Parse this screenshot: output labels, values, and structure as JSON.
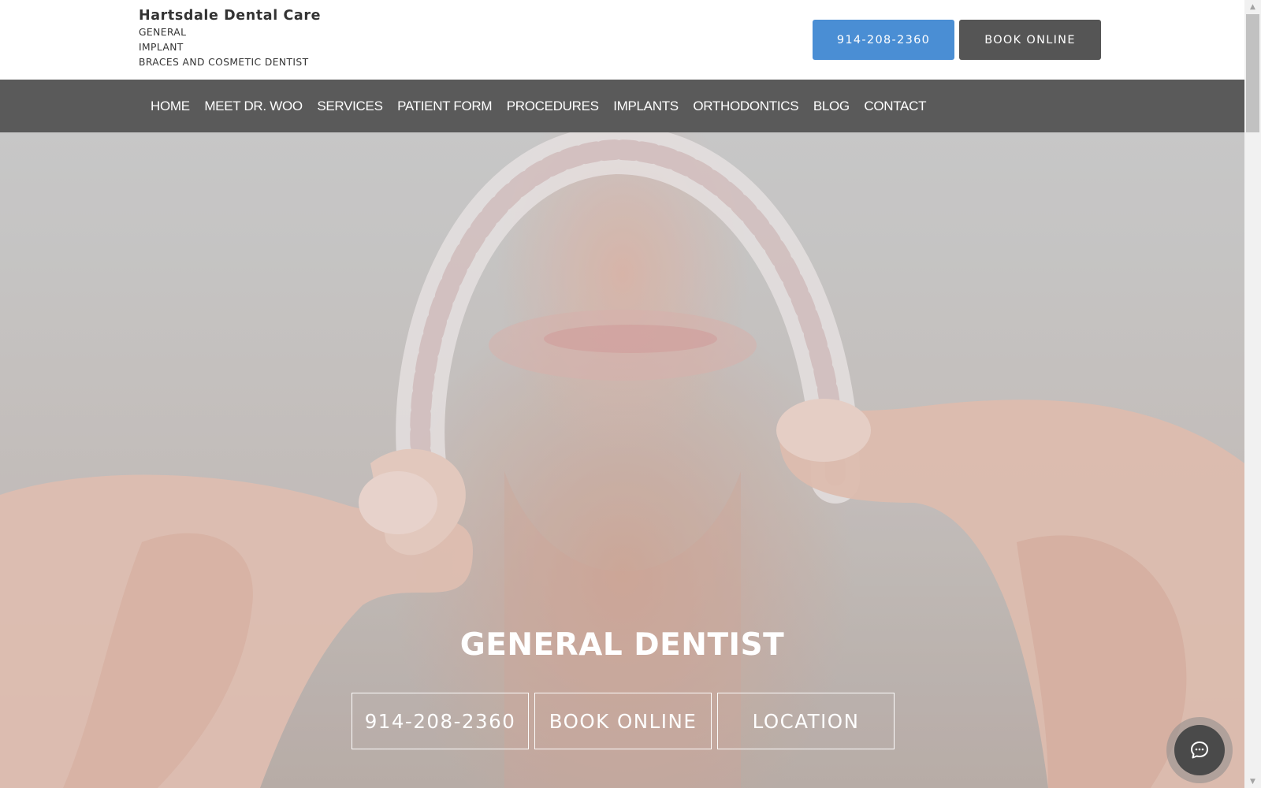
{
  "header": {
    "brand_name": "Hartsdale Dental Care",
    "brand_lines": [
      "GENERAL",
      "IMPLANT",
      "BRACES AND COSMETIC DENTIST"
    ],
    "phone_button": "914-208-2360",
    "book_button": "BOOK ONLINE",
    "colors": {
      "phone_button_bg": "#4a8ed4",
      "book_button_bg": "#555555"
    }
  },
  "nav": {
    "background": "#5a5a5a",
    "items": [
      "HOME",
      "MEET DR. WOO",
      "SERVICES",
      "PATIENT FORM",
      "PROCEDURES",
      "IMPLANTS",
      "ORTHODONTICS",
      "BLOG",
      "CONTACT"
    ]
  },
  "hero": {
    "image_subject": "person holding clear aligner",
    "title": "GENERAL DENTIST",
    "buttons": [
      "914-208-2360",
      "BOOK ONLINE",
      "LOCATION"
    ]
  },
  "chat_widget": {
    "icon": "chat-bubble-icon"
  },
  "scrollbar": {
    "up_icon": "scroll-up-arrow-icon",
    "down_icon": "scroll-down-arrow-icon"
  }
}
